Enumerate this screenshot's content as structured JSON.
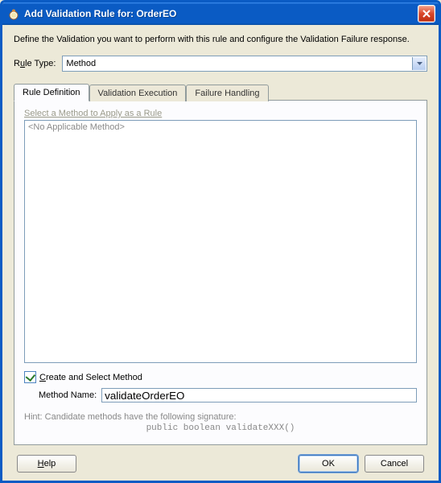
{
  "window": {
    "title": "Add Validation Rule for: OrderEO"
  },
  "intro": "Define the Validation you want to perform with this rule and configure the Validation Failure response.",
  "ruleType": {
    "label_pre": "R",
    "label_ul": "u",
    "label_post": "le Type:",
    "value": "Method"
  },
  "tabs": {
    "definition": "Rule Definition",
    "execution": "Validation Execution",
    "failure": "Failure Handling"
  },
  "panel": {
    "section_label": "Select a Method to Apply as a Rule",
    "list_placeholder": "<No Applicable Method>",
    "create_pre": "",
    "create_ul": "C",
    "create_post": "reate and Select Method",
    "method_name_label": "Method Name:",
    "method_name_value": "validateOrderEO",
    "hint": "Hint: Candidate methods have the following signature:",
    "signature": "public boolean validateXXX()"
  },
  "footer": {
    "help_ul": "H",
    "help_post": "elp",
    "ok": "OK",
    "cancel": "Cancel"
  }
}
